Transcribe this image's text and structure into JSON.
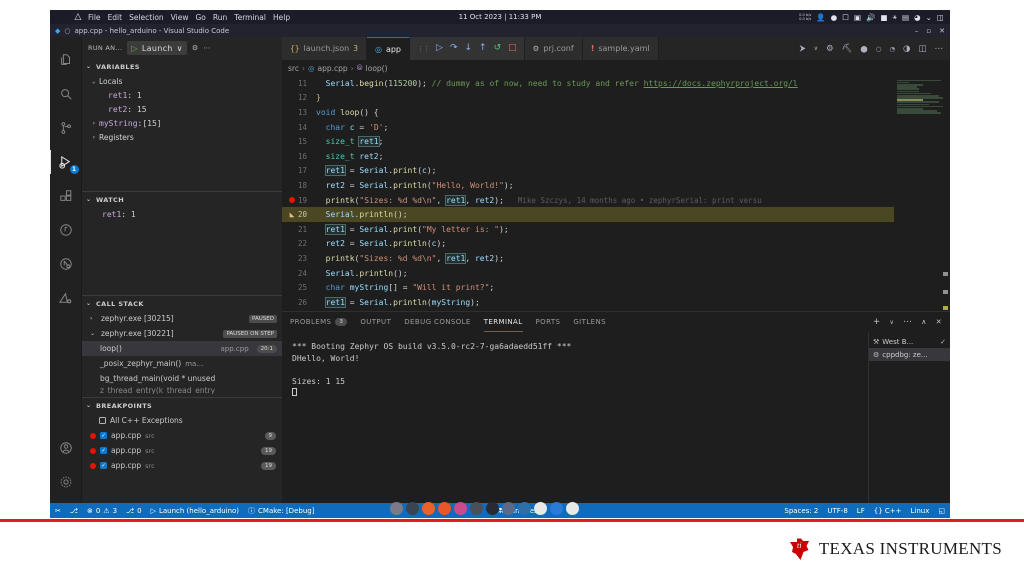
{
  "os": {
    "logo_icon": "arch-linux-icon",
    "menu": [
      "File",
      "Edit",
      "Selection",
      "View",
      "Go",
      "Run",
      "Terminal",
      "Help"
    ],
    "clock": "11 Oct 2023 | 11:33 PM",
    "net_up": "0.0 b/s",
    "net_down": "0.0 b/s",
    "tray_icons": [
      "user-icon",
      "shield-icon",
      "screenshot-icon",
      "clipboard-icon",
      "volume-icon",
      "battery-icon",
      "bluetooth-icon",
      "display-icon",
      "wifi-icon",
      "chevron-down-icon",
      "sidebar-icon"
    ]
  },
  "window": {
    "title": "app.cpp - hello_arduino - Visual Studio Code",
    "minimize": "–",
    "maximize": "▫",
    "close": "✕"
  },
  "activitybar": {
    "items": [
      {
        "name": "explorer",
        "icon": "files-icon",
        "active": false
      },
      {
        "name": "search",
        "icon": "search-icon",
        "active": false
      },
      {
        "name": "source-control",
        "icon": "source-control-icon",
        "active": false
      },
      {
        "name": "run-and-debug",
        "icon": "run-debug-icon",
        "active": true,
        "badge": "1"
      },
      {
        "name": "extensions",
        "icon": "extensions-icon",
        "active": false
      },
      {
        "name": "testing",
        "icon": "beaker-icon",
        "active": false
      },
      {
        "name": "cmake",
        "icon": "cmake-icon",
        "active": false
      },
      {
        "name": "platformio",
        "icon": "platformio-icon",
        "active": false
      }
    ],
    "bottom": [
      {
        "name": "accounts",
        "icon": "account-icon"
      },
      {
        "name": "settings",
        "icon": "gear-icon"
      }
    ]
  },
  "sidebar": {
    "title": "RUN AN...",
    "launch_config": "Launch",
    "chevron": "∨",
    "gear_icon": "gear-icon",
    "more_icon": "ellipsis-icon",
    "sections": {
      "variables": {
        "title": "VARIABLES",
        "groups": [
          {
            "label": "Locals",
            "expanded": true,
            "items": [
              {
                "name": "ret1",
                "value": "1"
              },
              {
                "name": "ret2",
                "value": "15"
              }
            ]
          },
          {
            "label": "myString",
            "value": "[15]",
            "expandable": true
          },
          {
            "label": "Registers",
            "expandable": true
          }
        ]
      },
      "watch": {
        "title": "WATCH",
        "items": [
          {
            "name": "ret1",
            "value": "1"
          }
        ]
      },
      "callstack": {
        "title": "CALL STACK",
        "threads": [
          {
            "label": "zephyr.exe [30215]",
            "state": "PAUSED",
            "expanded": false
          },
          {
            "label": "zephyr.exe [30221]",
            "state": "PAUSED ON STEP",
            "expanded": true
          }
        ],
        "frames": [
          {
            "fn": "loop()",
            "file": "app.cpp",
            "pos": "20:1",
            "selected": true
          },
          {
            "fn": "_posix_zephyr_main()",
            "file": "ma…",
            "selected": false
          },
          {
            "fn": "bg_thread_main(void * unused",
            "file": "",
            "selected": false
          },
          {
            "fn": "z_thread_entry(k_thread_entry",
            "file": "",
            "selected": false
          }
        ]
      },
      "breakpoints": {
        "title": "BREAKPOINTS",
        "items": [
          {
            "label": "All C++ Exceptions",
            "checked": false,
            "dot": false,
            "src": "",
            "line": ""
          },
          {
            "label": "app.cpp",
            "checked": true,
            "dot": true,
            "src": "src",
            "line": "9"
          },
          {
            "label": "app.cpp",
            "checked": true,
            "dot": true,
            "src": "src",
            "line": "19"
          },
          {
            "label": "app.cpp",
            "checked": true,
            "dot": true,
            "src": "src",
            "line": "19"
          }
        ]
      }
    }
  },
  "tabs": [
    {
      "label": "launch.json",
      "icon": "json-icon",
      "badge": "3",
      "active": false
    },
    {
      "label": "app",
      "icon": "cpp-icon",
      "badge": "",
      "active": true
    },
    {
      "label": "prj.conf",
      "icon": "gear-icon",
      "badge": "",
      "active": false
    },
    {
      "label": "sample.yaml",
      "icon": "warning-icon",
      "badge": "",
      "active": false
    }
  ],
  "debug_toolbar": {
    "grip_icon": "grip-icon",
    "buttons": [
      {
        "name": "continue",
        "icon": "play-icon",
        "glyph": "▷"
      },
      {
        "name": "step-over",
        "icon": "step-over-icon",
        "glyph": "↷"
      },
      {
        "name": "step-into",
        "icon": "step-into-icon",
        "glyph": "↓"
      },
      {
        "name": "step-out",
        "icon": "step-out-icon",
        "glyph": "↑"
      },
      {
        "name": "restart",
        "icon": "restart-icon",
        "glyph": "↺"
      },
      {
        "name": "stop",
        "icon": "stop-icon",
        "glyph": "□"
      }
    ]
  },
  "tab_actions": [
    {
      "name": "run-or-debug",
      "glyph": "⮞"
    },
    {
      "name": "chevron-down",
      "glyph": "∨"
    },
    {
      "name": "settings",
      "glyph": "⚙"
    },
    {
      "name": "build",
      "glyph": "⛏"
    },
    {
      "name": "add-breakpoint",
      "glyph": "⬤"
    },
    {
      "name": "disable-breakpoint",
      "glyph": "○"
    },
    {
      "name": "edit-breakpoint",
      "glyph": "◔"
    },
    {
      "name": "coverage",
      "glyph": "◑"
    },
    {
      "name": "split-editor",
      "glyph": "◫"
    },
    {
      "name": "more-actions",
      "glyph": "⋯"
    }
  ],
  "breadcrumb": {
    "folder": "src",
    "file": "app.cpp",
    "symbol": "loop()",
    "sep": "›"
  },
  "editor": {
    "blame": "Mike Szczys, 14 months ago • zephyrSerial: print versu",
    "lines": [
      {
        "n": "11",
        "mark": "",
        "hl": false,
        "tokens": [
          {
            "t": "  ",
            "c": "k-plain"
          },
          {
            "t": "Serial",
            "c": "k-var"
          },
          {
            "t": ".",
            "c": "k-plain"
          },
          {
            "t": "begin",
            "c": "k-fn"
          },
          {
            "t": "(",
            "c": "k-plain"
          },
          {
            "t": "115200",
            "c": "k-num"
          },
          {
            "t": "); ",
            "c": "k-plain"
          },
          {
            "t": "// dummy as of now, need to study and refer ",
            "c": "k-cmt"
          },
          {
            "t": "https://docs.zephyrproject.org/l",
            "c": "k-link"
          }
        ]
      },
      {
        "n": "12",
        "mark": "",
        "hl": false,
        "tokens": [
          {
            "t": "}",
            "c": "k-brace"
          }
        ]
      },
      {
        "n": "13",
        "mark": "",
        "hl": false,
        "tokens": [
          {
            "t": "void ",
            "c": "k-kw"
          },
          {
            "t": "loop",
            "c": "k-fn"
          },
          {
            "t": "() {",
            "c": "k-plain"
          }
        ]
      },
      {
        "n": "14",
        "mark": "",
        "hl": false,
        "tokens": [
          {
            "t": "  ",
            "c": "k-plain"
          },
          {
            "t": "char ",
            "c": "k-kw"
          },
          {
            "t": "c ",
            "c": "k-var"
          },
          {
            "t": "= ",
            "c": "k-plain"
          },
          {
            "t": "'D'",
            "c": "k-str"
          },
          {
            "t": ";",
            "c": "k-plain"
          }
        ]
      },
      {
        "n": "15",
        "mark": "",
        "hl": false,
        "tokens": [
          {
            "t": "  ",
            "c": "k-plain"
          },
          {
            "t": "size_t ",
            "c": "k-type"
          },
          {
            "t": "ret1",
            "c": "k-var k-hl-word"
          },
          {
            "t": ";",
            "c": "k-plain"
          }
        ]
      },
      {
        "n": "16",
        "mark": "",
        "hl": false,
        "tokens": [
          {
            "t": "  ",
            "c": "k-plain"
          },
          {
            "t": "size_t ",
            "c": "k-type"
          },
          {
            "t": "ret2",
            "c": "k-var"
          },
          {
            "t": ";",
            "c": "k-plain"
          }
        ]
      },
      {
        "n": "17",
        "mark": "",
        "hl": false,
        "tokens": [
          {
            "t": "  ",
            "c": "k-plain"
          },
          {
            "t": "ret1",
            "c": "k-var k-hl-word"
          },
          {
            "t": " = ",
            "c": "k-plain"
          },
          {
            "t": "Serial",
            "c": "k-var"
          },
          {
            "t": ".",
            "c": "k-plain"
          },
          {
            "t": "print",
            "c": "k-fn"
          },
          {
            "t": "(",
            "c": "k-plain"
          },
          {
            "t": "c",
            "c": "k-var"
          },
          {
            "t": ");",
            "c": "k-plain"
          }
        ]
      },
      {
        "n": "18",
        "mark": "",
        "hl": false,
        "tokens": [
          {
            "t": "  ",
            "c": "k-plain"
          },
          {
            "t": "ret2",
            "c": "k-var"
          },
          {
            "t": " = ",
            "c": "k-plain"
          },
          {
            "t": "Serial",
            "c": "k-var"
          },
          {
            "t": ".",
            "c": "k-plain"
          },
          {
            "t": "println",
            "c": "k-fn"
          },
          {
            "t": "(",
            "c": "k-plain"
          },
          {
            "t": "\"Hello, World!\"",
            "c": "k-str"
          },
          {
            "t": ");",
            "c": "k-plain"
          }
        ]
      },
      {
        "n": "19",
        "mark": "breakpoint",
        "hl": false,
        "blame": true,
        "tokens": [
          {
            "t": "  ",
            "c": "k-plain"
          },
          {
            "t": "printk",
            "c": "k-fn"
          },
          {
            "t": "(",
            "c": "k-plain"
          },
          {
            "t": "\"Sizes: %d %d\\n\"",
            "c": "k-str"
          },
          {
            "t": ", ",
            "c": "k-plain"
          },
          {
            "t": "ret1",
            "c": "k-var k-hl-word"
          },
          {
            "t": ", ",
            "c": "k-plain"
          },
          {
            "t": "ret2",
            "c": "k-var"
          },
          {
            "t": ");",
            "c": "k-plain"
          }
        ]
      },
      {
        "n": "20",
        "mark": "current",
        "hl": true,
        "tokens": [
          {
            "t": "  ",
            "c": "k-plain"
          },
          {
            "t": "Serial",
            "c": "k-var"
          },
          {
            "t": ".",
            "c": "k-plain"
          },
          {
            "t": "println",
            "c": "k-fn"
          },
          {
            "t": "();",
            "c": "k-plain"
          }
        ]
      },
      {
        "n": "21",
        "mark": "",
        "hl": false,
        "tokens": [
          {
            "t": "  ",
            "c": "k-plain"
          },
          {
            "t": "ret1",
            "c": "k-var k-hl-word"
          },
          {
            "t": " = ",
            "c": "k-plain"
          },
          {
            "t": "Serial",
            "c": "k-var"
          },
          {
            "t": ".",
            "c": "k-plain"
          },
          {
            "t": "print",
            "c": "k-fn"
          },
          {
            "t": "(",
            "c": "k-plain"
          },
          {
            "t": "\"My letter is: \"",
            "c": "k-str"
          },
          {
            "t": ");",
            "c": "k-plain"
          }
        ]
      },
      {
        "n": "22",
        "mark": "",
        "hl": false,
        "tokens": [
          {
            "t": "  ",
            "c": "k-plain"
          },
          {
            "t": "ret2",
            "c": "k-var"
          },
          {
            "t": " = ",
            "c": "k-plain"
          },
          {
            "t": "Serial",
            "c": "k-var"
          },
          {
            "t": ".",
            "c": "k-plain"
          },
          {
            "t": "println",
            "c": "k-fn"
          },
          {
            "t": "(",
            "c": "k-plain"
          },
          {
            "t": "c",
            "c": "k-var"
          },
          {
            "t": ");",
            "c": "k-plain"
          }
        ]
      },
      {
        "n": "23",
        "mark": "",
        "hl": false,
        "tokens": [
          {
            "t": "  ",
            "c": "k-plain"
          },
          {
            "t": "printk",
            "c": "k-fn"
          },
          {
            "t": "(",
            "c": "k-plain"
          },
          {
            "t": "\"Sizes: %d %d\\n\"",
            "c": "k-str"
          },
          {
            "t": ", ",
            "c": "k-plain"
          },
          {
            "t": "ret1",
            "c": "k-var k-hl-word"
          },
          {
            "t": ", ",
            "c": "k-plain"
          },
          {
            "t": "ret2",
            "c": "k-var"
          },
          {
            "t": ");",
            "c": "k-plain"
          }
        ]
      },
      {
        "n": "24",
        "mark": "",
        "hl": false,
        "tokens": [
          {
            "t": "  ",
            "c": "k-plain"
          },
          {
            "t": "Serial",
            "c": "k-var"
          },
          {
            "t": ".",
            "c": "k-plain"
          },
          {
            "t": "println",
            "c": "k-fn"
          },
          {
            "t": "();",
            "c": "k-plain"
          }
        ]
      },
      {
        "n": "25",
        "mark": "",
        "hl": false,
        "tokens": [
          {
            "t": "  ",
            "c": "k-plain"
          },
          {
            "t": "char ",
            "c": "k-kw"
          },
          {
            "t": "myString",
            "c": "k-var"
          },
          {
            "t": "[] = ",
            "c": "k-plain"
          },
          {
            "t": "\"Will it print?\"",
            "c": "k-str"
          },
          {
            "t": ";",
            "c": "k-plain"
          }
        ]
      },
      {
        "n": "26",
        "mark": "",
        "hl": false,
        "tokens": [
          {
            "t": "  ",
            "c": "k-plain"
          },
          {
            "t": "ret1",
            "c": "k-var k-hl-word"
          },
          {
            "t": " = ",
            "c": "k-plain"
          },
          {
            "t": "Serial",
            "c": "k-var"
          },
          {
            "t": ".",
            "c": "k-plain"
          },
          {
            "t": "println",
            "c": "k-fn"
          },
          {
            "t": "(",
            "c": "k-plain"
          },
          {
            "t": "myString",
            "c": "k-var"
          },
          {
            "t": ");",
            "c": "k-plain"
          }
        ]
      }
    ]
  },
  "panel": {
    "tabs": [
      {
        "label": "PROBLEMS",
        "badge": "3",
        "active": false
      },
      {
        "label": "OUTPUT",
        "badge": "",
        "active": false
      },
      {
        "label": "DEBUG CONSOLE",
        "badge": "",
        "active": false
      },
      {
        "label": "TERMINAL",
        "badge": "",
        "active": true
      },
      {
        "label": "PORTS",
        "badge": "",
        "active": false
      },
      {
        "label": "GITLENS",
        "badge": "",
        "active": false
      }
    ],
    "actions": [
      {
        "name": "new-terminal",
        "glyph": "+"
      },
      {
        "name": "terminal-dropdown",
        "glyph": "∨"
      },
      {
        "name": "more-actions",
        "glyph": "⋯"
      },
      {
        "name": "maximize-panel",
        "glyph": "∧"
      },
      {
        "name": "close-panel",
        "glyph": "✕"
      }
    ],
    "terminal_output": "*** Booting Zephyr OS build v3.5.0-rc2-7-ga6adaedd51ff ***\nDHello, World!\n\nSizes: 1 15",
    "terminal_list": [
      {
        "label": "West B...",
        "icon": "tools-icon",
        "active": false,
        "check": "✓"
      },
      {
        "label": "cppdbg: ze...",
        "icon": "debug-icon",
        "active": true,
        "check": ""
      }
    ]
  },
  "statusbar": {
    "left": [
      {
        "name": "remote",
        "glyph": "✂",
        "label": ""
      },
      {
        "name": "branch",
        "glyph": "⎇",
        "label": ""
      },
      {
        "name": "errors",
        "glyph": "⊗",
        "label": "0"
      },
      {
        "name": "warnings",
        "glyph": "⚠",
        "label": "3"
      },
      {
        "name": "ports",
        "glyph": "⎇",
        "label": "0"
      },
      {
        "name": "launch-config",
        "glyph": "▷",
        "label": "Launch (hello_arduino)"
      },
      {
        "name": "cmake-build-variant",
        "glyph": "ⓘ",
        "label": "CMake: [Debug]"
      }
    ],
    "run_ctest": {
      "glyph": "⚗",
      "label": "Run CTest",
      "play": "▷"
    },
    "right": [
      {
        "name": "indentation",
        "label": "Spaces: 2"
      },
      {
        "name": "encoding",
        "label": "UTF-8"
      },
      {
        "name": "eol",
        "label": "LF"
      },
      {
        "name": "language-mode",
        "label": "{} C++"
      },
      {
        "name": "platform",
        "label": "Linux"
      },
      {
        "name": "notifications",
        "label": "◱"
      }
    ]
  },
  "taskbar_colors": [
    "#7a7a88",
    "#3a4452",
    "#e8622a",
    "#e8562a",
    "#c94b8e",
    "#4a5058",
    "#2a2a32",
    "#5a6a88",
    "#2f6fa8",
    "#e8e8e8",
    "#2a7ad8",
    "#e8e8e8"
  ],
  "branding": {
    "name": "TEXAS INSTRUMENTS",
    "logo_icon": "texas-instruments-logo",
    "accent": "#e01b24",
    "red": "#cc0000"
  }
}
